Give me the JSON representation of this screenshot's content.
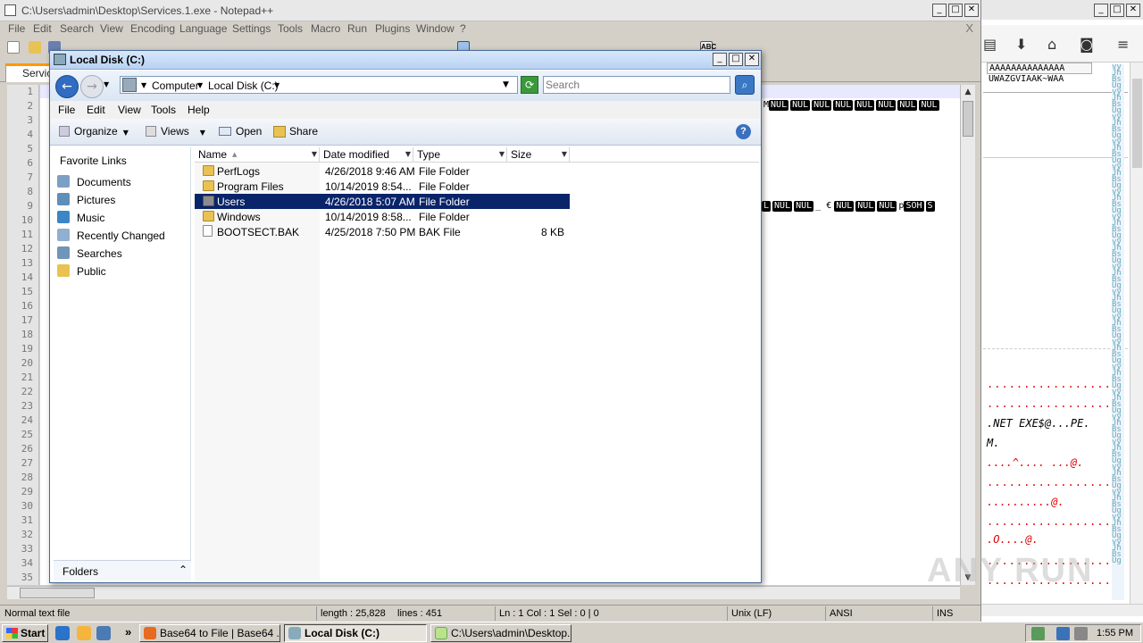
{
  "notepad": {
    "title": "C:\\Users\\admin\\Desktop\\Services.1.exe - Notepad++",
    "menu": [
      "File",
      "Edit",
      "Search",
      "View",
      "Encoding",
      "Language",
      "Settings",
      "Tools",
      "Macro",
      "Run",
      "Plugins",
      "Window",
      "?"
    ],
    "close_doc": "X",
    "tab_label": "Servic",
    "line_numbers": [
      "1",
      "2",
      "3",
      "4",
      "5",
      "6",
      "7",
      "8",
      "9",
      "10",
      "11",
      "12",
      "13",
      "14",
      "15",
      "16",
      "17",
      "18",
      "19",
      "20",
      "21",
      "22",
      "23",
      "24",
      "25",
      "26",
      "27",
      "28",
      "29",
      "30",
      "31",
      "32",
      "33",
      "34",
      "35"
    ],
    "line2_nuls": [
      "NUL",
      "NUL",
      "NUL",
      "NUL",
      "NUL",
      "NUL",
      "NUL",
      "NUL"
    ],
    "line2_prefix": "M",
    "line9_nuls_a": [
      "L",
      "NUL",
      "NUL"
    ],
    "line9_mid": "_  €",
    "line9_nuls_b": [
      "NUL",
      "NUL",
      "NUL"
    ],
    "line9_tail": "p",
    "line9_nuls_c": [
      "SOH",
      "S"
    ],
    "status": {
      "file_type": "Normal text file",
      "length": "length : 25,828",
      "lines": "lines : 451",
      "position": "Ln : 1    Col : 1    Sel : 0 | 0",
      "eol": "Unix (LF)",
      "encoding": "ANSI",
      "mode": "INS"
    }
  },
  "right_window": {
    "top_text_1": "AAAAAAAAAAAAAA",
    "top_text_2": "UWAZGVIAAK~WAA",
    "lines": [
      ".NET EXE$@...PE.",
      "M.",
      "....^....  ...@.",
      "..........@.",
      ".O....@."
    ],
    "dots": ".................."
  },
  "explorer": {
    "title": "Local Disk (C:)",
    "breadcrumb": [
      "Computer",
      "Local Disk (C:)"
    ],
    "search_placeholder": "Search",
    "menu": [
      "File",
      "Edit",
      "View",
      "Tools",
      "Help"
    ],
    "commands": {
      "organize": "Organize",
      "views": "Views",
      "open": "Open",
      "share": "Share"
    },
    "favorites_header": "Favorite Links",
    "favorites": [
      "Documents",
      "Pictures",
      "Music",
      "Recently Changed",
      "Searches",
      "Public"
    ],
    "folders_label": "Folders",
    "columns": [
      "Name",
      "Date modified",
      "Type",
      "Size"
    ],
    "files": [
      {
        "name": "PerfLogs",
        "date": "4/26/2018 9:46 AM",
        "type": "File Folder",
        "size": ""
      },
      {
        "name": "Program Files",
        "date": "10/14/2019 8:54...",
        "type": "File Folder",
        "size": ""
      },
      {
        "name": "Users",
        "date": "4/26/2018 5:07 AM",
        "type": "File Folder",
        "size": ""
      },
      {
        "name": "Windows",
        "date": "10/14/2019 8:58...",
        "type": "File Folder",
        "size": ""
      },
      {
        "name": "BOOTSECT.BAK",
        "date": "4/25/2018 7:50 PM",
        "type": "BAK File",
        "size": "8 KB"
      }
    ],
    "selected_index": 2
  },
  "taskbar": {
    "start": "Start",
    "overflow": "»",
    "tasks": [
      "Base64 to File | Base64 ...",
      "Local Disk (C:)",
      "C:\\Users\\admin\\Desktop..."
    ],
    "clock": "1:55 PM"
  },
  "watermark": "ANY RUN",
  "colors": {
    "selection": "#0a246a",
    "folder": "#e8c253",
    "tab_accent": "#ff9900"
  }
}
